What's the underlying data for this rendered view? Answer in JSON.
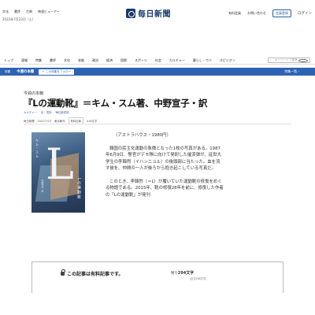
{
  "util": {
    "links": [
      "文化",
      "書評",
      "古典",
      "毎週ビューアー"
    ],
    "date": "2022年7月23日（土）"
  },
  "logo": {
    "text": "毎日新聞"
  },
  "util_right": {
    "links": [
      "有料会員",
      "お問い合わせ",
      "ログイン"
    ],
    "member_button": "会員登録",
    "login": "ログイン"
  },
  "nav": {
    "items": [
      "トップ",
      "速報",
      "特集",
      "書評",
      "文化",
      "芸能",
      "政治",
      "経済",
      "国際",
      "スポーツ",
      "社会",
      "カルチャー",
      "暮らし・ワバ",
      "生活",
      "オピニオン"
    ],
    "search_placeholder": "キーワードで検索"
  },
  "special": {
    "label": "特集",
    "title": "今週の本棚",
    "follow_button": "この特集をフォロー",
    "right": "特集一覧 ›"
  },
  "article": {
    "kicker": "今週の本棚",
    "headline": "『Lの運動靴』＝キム・スム著、中野宣子・訳",
    "tags": [
      "カルチャー",
      "本・書評",
      "毎日新書評"
    ],
    "meta": {
      "paper": "毎日新聞",
      "date": "2022/7/23",
      "edition": "東京朝刊",
      "chip": "有料記事",
      "words": "418文字"
    }
  },
  "cover": {
    "big_letter": "L",
    "author_vertical": "キム・スム",
    "title_vertical": "Lの運動靴",
    "translator_vertical": "中野宣子 訳"
  },
  "body": {
    "publisher": "（アストラハウス・1980円）",
    "p1": "韓国の民主化運動の象徴となった1枚の写真がある。1987年6月9日、警官がデモ隊に向けて発射した催涙弾が、延世大学生の李韓烈（イハンニョル）の後頭部に当たった。血を流す彼を、仲間の一人が後ろから抱き起こしている写真だ。",
    "p2": "このとき、李韓烈（＝L）が履いていた運動靴の修復をめぐる物語である。2015年、靴の修復28年を前に、修復した作者の「Lの運動靴」が発刊"
  },
  "paywall": {
    "title": "この記事は有料記事です。",
    "remain_label": "残り",
    "remain_count": "294文字",
    "remain_suffix": "（全文466文字）"
  },
  "colors": {
    "accent": "#2d63b3",
    "brand": "#1a3a6b"
  }
}
